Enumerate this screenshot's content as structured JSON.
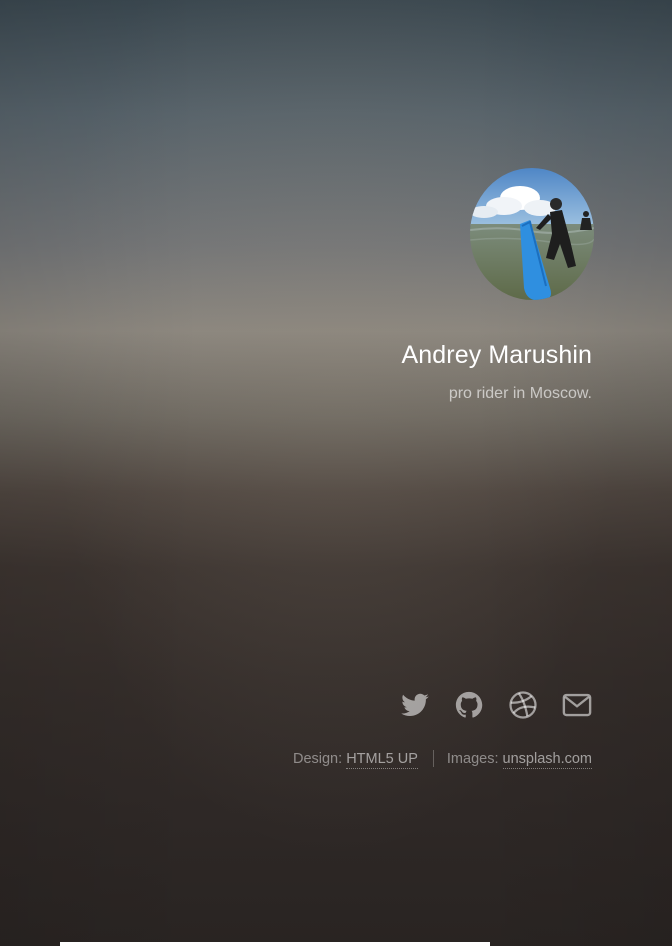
{
  "profile": {
    "name": "Andrey Marushin",
    "tagline": "pro rider in Moscow.",
    "avatar_icon": "surfer-photo"
  },
  "social": [
    {
      "icon": "twitter-icon"
    },
    {
      "icon": "github-icon"
    },
    {
      "icon": "dribbble-icon"
    },
    {
      "icon": "envelope-icon"
    }
  ],
  "credits": {
    "design_prefix": "Design:",
    "design_link": "HTML5 UP",
    "images_prefix": "Images:",
    "images_link": "unsplash.com"
  },
  "colors": {
    "text": "#ffffff",
    "icon": "#a6a4a3",
    "sea": "#6b7a63",
    "board": "#2f8fe0"
  }
}
